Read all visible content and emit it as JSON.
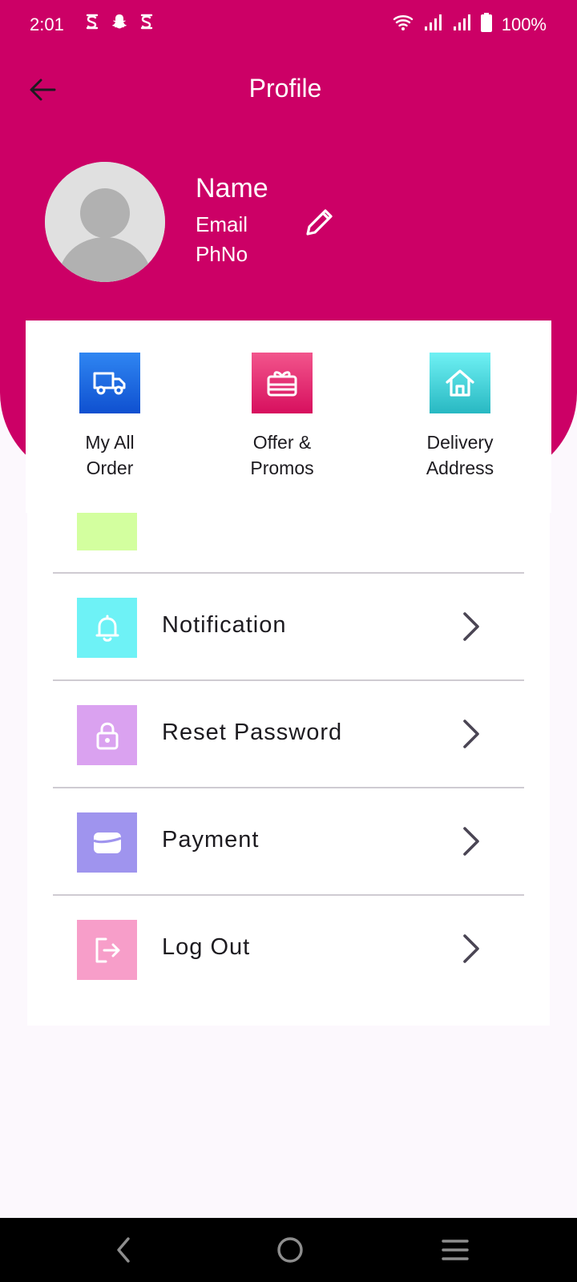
{
  "status_bar": {
    "time": "2:01",
    "battery": "100%",
    "notification_icons": [
      "s-icon",
      "snapchat-icon",
      "s-icon"
    ]
  },
  "app_bar": {
    "title": "Profile",
    "back_icon": "arrow-left-icon"
  },
  "profile": {
    "name": "Name",
    "email": "Email",
    "phone": "PhNo",
    "edit_icon": "pencil-icon"
  },
  "quick_actions": [
    {
      "label_line1": "My All",
      "label_line2": "Order",
      "icon": "truck-icon",
      "color": "#1a66e0"
    },
    {
      "label_line1": "Offer &",
      "label_line2": "Promos",
      "icon": "gift-card-icon",
      "color": "#e0246e"
    },
    {
      "label_line1": "Delivery",
      "label_line2": "Address",
      "icon": "home-icon",
      "color": "#3ccfd6"
    }
  ],
  "settings_list": [
    {
      "label": "Notification",
      "icon": "bell-icon",
      "color": "#6ef2f6"
    },
    {
      "label": "Reset Password",
      "icon": "lock-icon",
      "color": "#daa2f0"
    },
    {
      "label": "Payment",
      "icon": "wallet-icon",
      "color": "#9f94ee"
    },
    {
      "label": "Log Out",
      "icon": "logout-icon",
      "color": "#f79ec9"
    }
  ],
  "partial_item": {
    "color": "#d3ff9f"
  },
  "colors": {
    "primary": "#cc0066",
    "background": "#fcf8fd"
  }
}
